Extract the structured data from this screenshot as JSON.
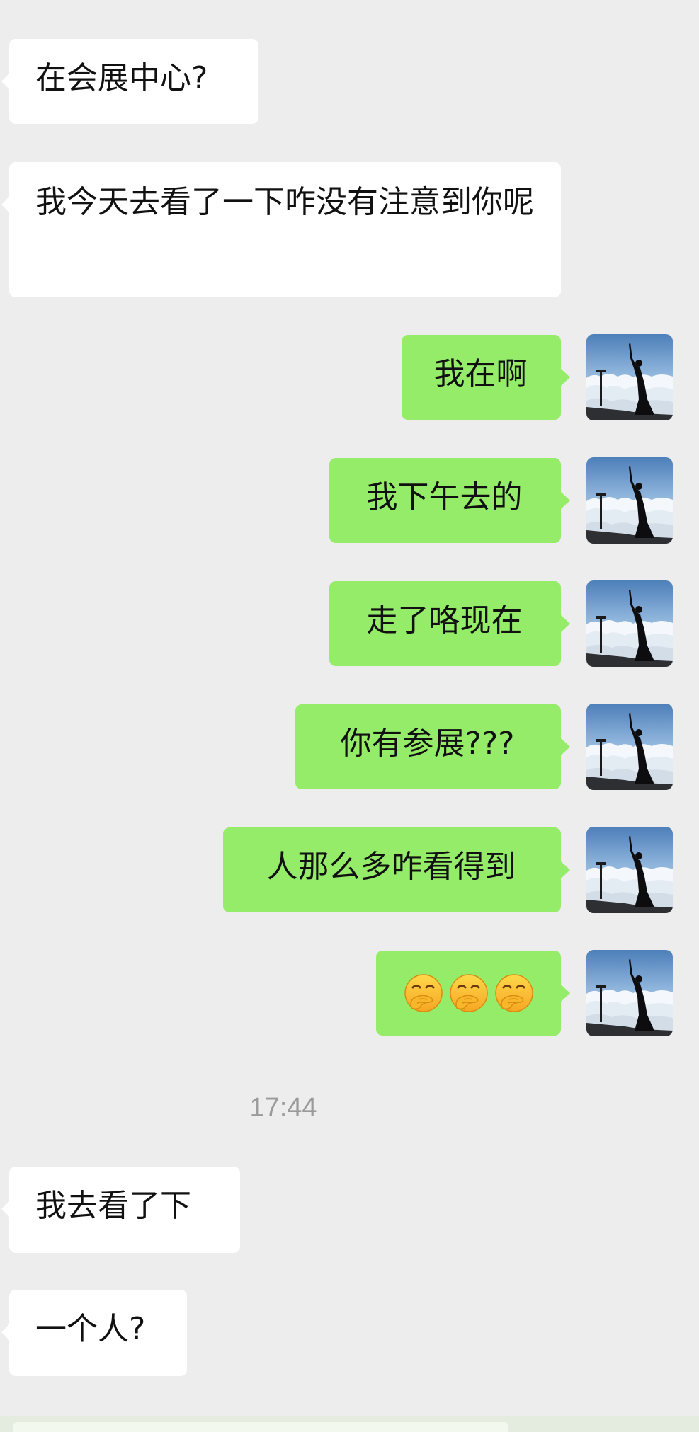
{
  "messages": [
    {
      "side": "in",
      "text": "在会展中心?"
    },
    {
      "side": "in",
      "text": "我今天去看了一下咋没有注意到你呢"
    },
    {
      "side": "out",
      "text": "我在啊"
    },
    {
      "side": "out",
      "text": "我下午去的"
    },
    {
      "side": "out",
      "text": "走了咯现在"
    },
    {
      "side": "out",
      "text": "你有参展???"
    },
    {
      "side": "out",
      "text": "人那么多咋看得到"
    },
    {
      "side": "out",
      "emoji": [
        "thinking-hand-over-mouth",
        "thinking-hand-over-mouth",
        "thinking-hand-over-mouth"
      ]
    },
    {
      "side": "in",
      "text": "我去看了下"
    },
    {
      "side": "in",
      "text": "一个人?"
    }
  ],
  "timestamp": "17:44",
  "colors": {
    "background": "#ededed",
    "incoming_bubble": "#ffffff",
    "outgoing_bubble": "#95ec69",
    "timestamp_text": "#9a9a9a"
  },
  "icons": {
    "avatar": "avatar-silhouette-sea-of-clouds",
    "emoji": "hand-over-mouth-smile-emoji"
  }
}
